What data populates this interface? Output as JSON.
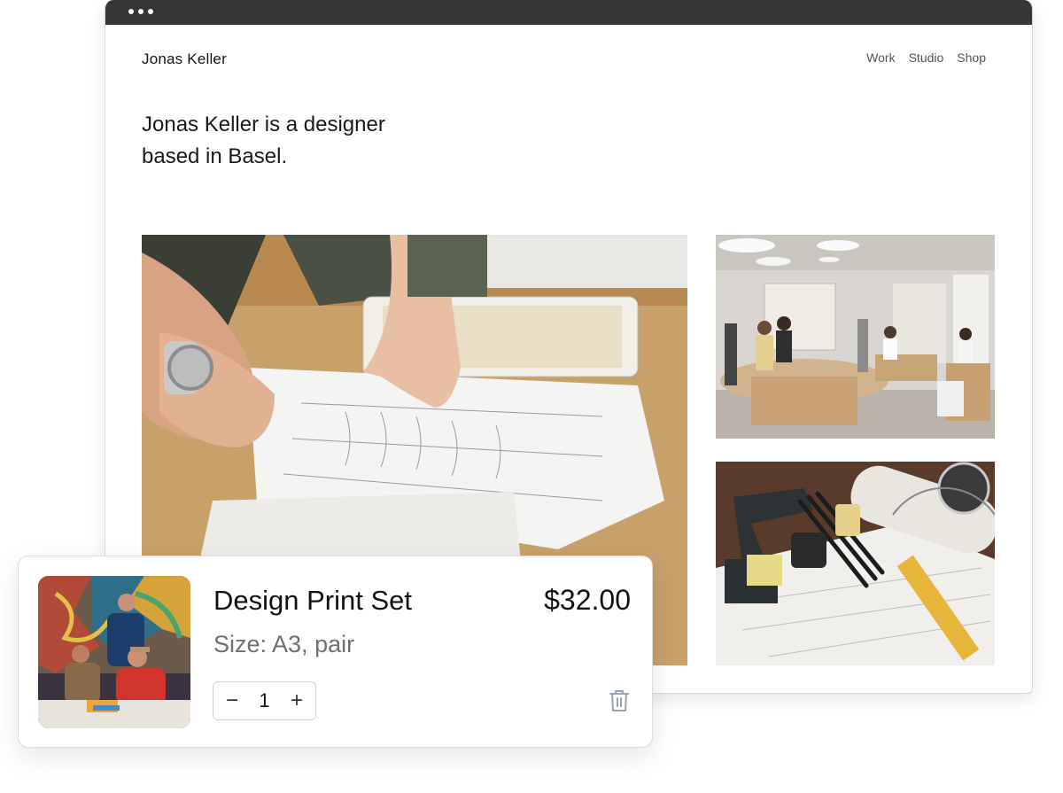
{
  "site": {
    "brand": "Jonas Keller",
    "nav": [
      "Work",
      "Studio",
      "Shop"
    ],
    "intro": "Jonas Keller is a designer based in Basel."
  },
  "images": {
    "main": "hands-sketch-photo",
    "studio": "studio-photo",
    "tools": "drafting-tools-photo"
  },
  "cart_item": {
    "name": "Design Print Set",
    "price": "$32.00",
    "size": "Size: A3, pair",
    "quantity": "1",
    "minus": "−",
    "plus": "+",
    "thumbnail": "team-photo",
    "remove_icon": "trash-icon"
  },
  "colors": {
    "titlebar": "#363636",
    "price_text": "#111111",
    "muted_text": "#6f6f6f"
  }
}
